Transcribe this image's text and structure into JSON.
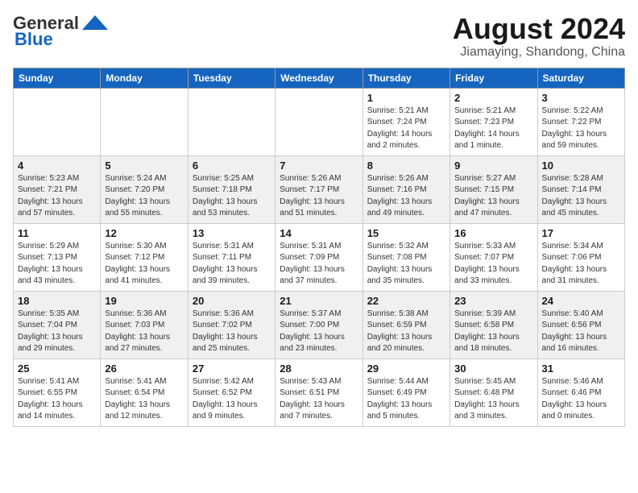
{
  "logo": {
    "general": "General",
    "blue": "Blue"
  },
  "title": {
    "month_year": "August 2024",
    "location": "Jiamaying, Shandong, China"
  },
  "days_of_week": [
    "Sunday",
    "Monday",
    "Tuesday",
    "Wednesday",
    "Thursday",
    "Friday",
    "Saturday"
  ],
  "weeks": [
    [
      {
        "day": "",
        "detail": ""
      },
      {
        "day": "",
        "detail": ""
      },
      {
        "day": "",
        "detail": ""
      },
      {
        "day": "",
        "detail": ""
      },
      {
        "day": "1",
        "detail": "Sunrise: 5:21 AM\nSunset: 7:24 PM\nDaylight: 14 hours\nand 2 minutes."
      },
      {
        "day": "2",
        "detail": "Sunrise: 5:21 AM\nSunset: 7:23 PM\nDaylight: 14 hours\nand 1 minute."
      },
      {
        "day": "3",
        "detail": "Sunrise: 5:22 AM\nSunset: 7:22 PM\nDaylight: 13 hours\nand 59 minutes."
      }
    ],
    [
      {
        "day": "4",
        "detail": "Sunrise: 5:23 AM\nSunset: 7:21 PM\nDaylight: 13 hours\nand 57 minutes."
      },
      {
        "day": "5",
        "detail": "Sunrise: 5:24 AM\nSunset: 7:20 PM\nDaylight: 13 hours\nand 55 minutes."
      },
      {
        "day": "6",
        "detail": "Sunrise: 5:25 AM\nSunset: 7:18 PM\nDaylight: 13 hours\nand 53 minutes."
      },
      {
        "day": "7",
        "detail": "Sunrise: 5:26 AM\nSunset: 7:17 PM\nDaylight: 13 hours\nand 51 minutes."
      },
      {
        "day": "8",
        "detail": "Sunrise: 5:26 AM\nSunset: 7:16 PM\nDaylight: 13 hours\nand 49 minutes."
      },
      {
        "day": "9",
        "detail": "Sunrise: 5:27 AM\nSunset: 7:15 PM\nDaylight: 13 hours\nand 47 minutes."
      },
      {
        "day": "10",
        "detail": "Sunrise: 5:28 AM\nSunset: 7:14 PM\nDaylight: 13 hours\nand 45 minutes."
      }
    ],
    [
      {
        "day": "11",
        "detail": "Sunrise: 5:29 AM\nSunset: 7:13 PM\nDaylight: 13 hours\nand 43 minutes."
      },
      {
        "day": "12",
        "detail": "Sunrise: 5:30 AM\nSunset: 7:12 PM\nDaylight: 13 hours\nand 41 minutes."
      },
      {
        "day": "13",
        "detail": "Sunrise: 5:31 AM\nSunset: 7:11 PM\nDaylight: 13 hours\nand 39 minutes."
      },
      {
        "day": "14",
        "detail": "Sunrise: 5:31 AM\nSunset: 7:09 PM\nDaylight: 13 hours\nand 37 minutes."
      },
      {
        "day": "15",
        "detail": "Sunrise: 5:32 AM\nSunset: 7:08 PM\nDaylight: 13 hours\nand 35 minutes."
      },
      {
        "day": "16",
        "detail": "Sunrise: 5:33 AM\nSunset: 7:07 PM\nDaylight: 13 hours\nand 33 minutes."
      },
      {
        "day": "17",
        "detail": "Sunrise: 5:34 AM\nSunset: 7:06 PM\nDaylight: 13 hours\nand 31 minutes."
      }
    ],
    [
      {
        "day": "18",
        "detail": "Sunrise: 5:35 AM\nSunset: 7:04 PM\nDaylight: 13 hours\nand 29 minutes."
      },
      {
        "day": "19",
        "detail": "Sunrise: 5:36 AM\nSunset: 7:03 PM\nDaylight: 13 hours\nand 27 minutes."
      },
      {
        "day": "20",
        "detail": "Sunrise: 5:36 AM\nSunset: 7:02 PM\nDaylight: 13 hours\nand 25 minutes."
      },
      {
        "day": "21",
        "detail": "Sunrise: 5:37 AM\nSunset: 7:00 PM\nDaylight: 13 hours\nand 23 minutes."
      },
      {
        "day": "22",
        "detail": "Sunrise: 5:38 AM\nSunset: 6:59 PM\nDaylight: 13 hours\nand 20 minutes."
      },
      {
        "day": "23",
        "detail": "Sunrise: 5:39 AM\nSunset: 6:58 PM\nDaylight: 13 hours\nand 18 minutes."
      },
      {
        "day": "24",
        "detail": "Sunrise: 5:40 AM\nSunset: 6:56 PM\nDaylight: 13 hours\nand 16 minutes."
      }
    ],
    [
      {
        "day": "25",
        "detail": "Sunrise: 5:41 AM\nSunset: 6:55 PM\nDaylight: 13 hours\nand 14 minutes."
      },
      {
        "day": "26",
        "detail": "Sunrise: 5:41 AM\nSunset: 6:54 PM\nDaylight: 13 hours\nand 12 minutes."
      },
      {
        "day": "27",
        "detail": "Sunrise: 5:42 AM\nSunset: 6:52 PM\nDaylight: 13 hours\nand 9 minutes."
      },
      {
        "day": "28",
        "detail": "Sunrise: 5:43 AM\nSunset: 6:51 PM\nDaylight: 13 hours\nand 7 minutes."
      },
      {
        "day": "29",
        "detail": "Sunrise: 5:44 AM\nSunset: 6:49 PM\nDaylight: 13 hours\nand 5 minutes."
      },
      {
        "day": "30",
        "detail": "Sunrise: 5:45 AM\nSunset: 6:48 PM\nDaylight: 13 hours\nand 3 minutes."
      },
      {
        "day": "31",
        "detail": "Sunrise: 5:46 AM\nSunset: 6:46 PM\nDaylight: 13 hours\nand 0 minutes."
      }
    ]
  ]
}
